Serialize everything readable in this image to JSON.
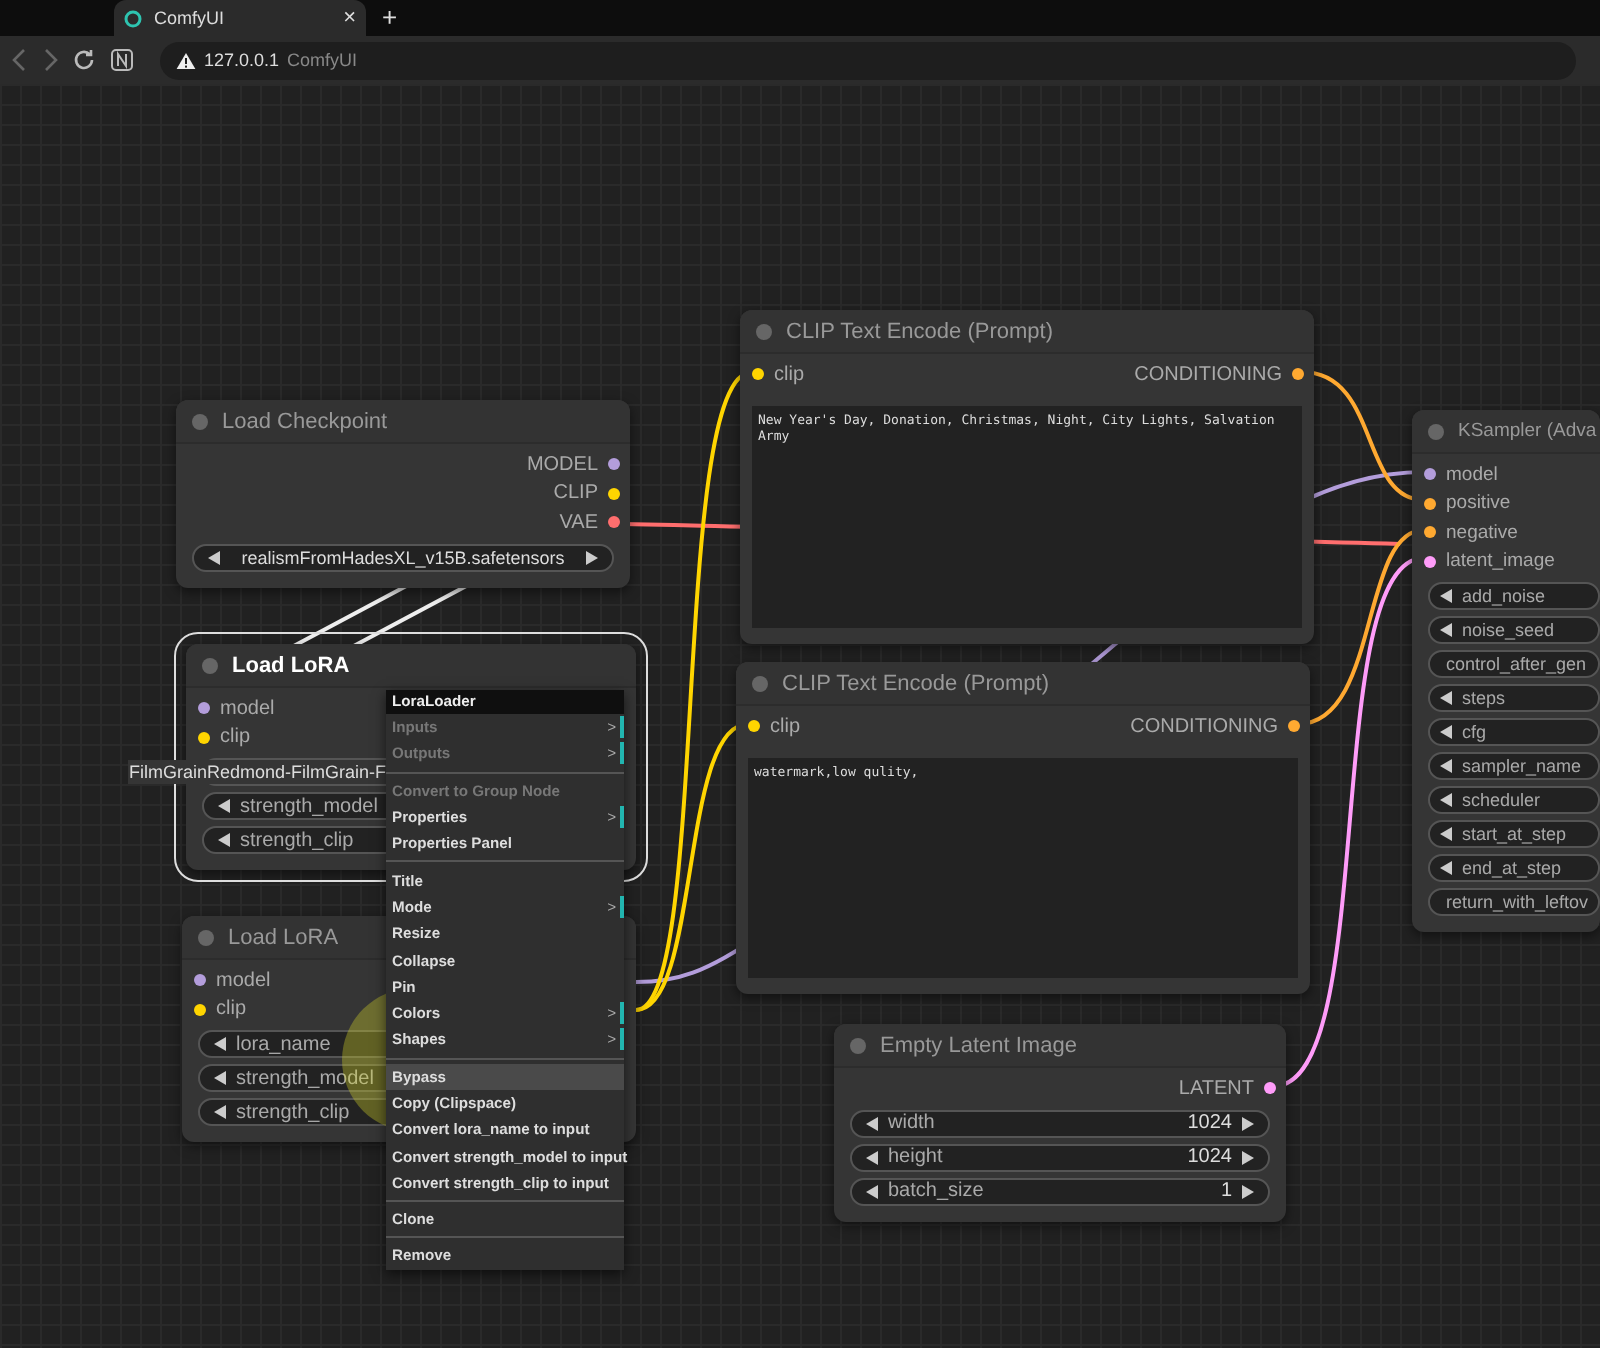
{
  "browser": {
    "tab": {
      "title": "ComfyUI",
      "close": "×"
    },
    "new_tab": "+",
    "address": {
      "host": "127.0.0.1",
      "page_title": "ComfyUI"
    }
  },
  "nodes": [
    {
      "title": "CLIP Text Encode (Prompt)",
      "selected": false,
      "inputs": [
        {
          "name": "clip",
          "color": "#ffd500"
        }
      ],
      "outputs": [
        {
          "name": "CONDITIONING",
          "color": "#ffa931"
        }
      ],
      "text": "New Year's Day, Donation, Christmas, Night, City Lights, Salvation Army"
    },
    {
      "title": "Load Checkpoint",
      "selected": false,
      "outputs": [
        {
          "name": "MODEL",
          "color": "#b39ddb"
        },
        {
          "name": "CLIP",
          "color": "#ffd500"
        },
        {
          "name": "VAE",
          "color": "#ff6e6e"
        }
      ],
      "widgets": [
        {
          "value": "realismFromHadesXL_v15B.safetensors"
        }
      ]
    },
    {
      "title": "KSampler (Adva",
      "selected": false,
      "inputs": [
        {
          "name": "model",
          "color": "#b39ddb"
        },
        {
          "name": "positive",
          "color": "#ffa931"
        },
        {
          "name": "negative",
          "color": "#ffa931"
        },
        {
          "name": "latent_image",
          "color": "#ff9cf9"
        }
      ],
      "widgets": [
        {
          "label": "add_noise"
        },
        {
          "label": "noise_seed"
        },
        {
          "label": "control_after_gen"
        },
        {
          "label": "steps"
        },
        {
          "label": "cfg"
        },
        {
          "label": "sampler_name"
        },
        {
          "label": "scheduler"
        },
        {
          "label": "start_at_step"
        },
        {
          "label": "end_at_step"
        },
        {
          "label": "return_with_leftov"
        }
      ]
    },
    {
      "title": "Load LoRA",
      "selected": true,
      "inputs": [
        {
          "name": "model",
          "color": "#b39ddb"
        },
        {
          "name": "clip",
          "color": "#ffd500"
        }
      ],
      "widgets": [
        {
          "value": "FilmGrainRedmond-FilmGrain-F"
        },
        {
          "label": "strength_model"
        },
        {
          "label": "strength_clip"
        }
      ]
    },
    {
      "title": "CLIP Text Encode (Prompt)",
      "selected": false,
      "inputs": [
        {
          "name": "clip",
          "color": "#ffd500"
        }
      ],
      "outputs": [
        {
          "name": "CONDITIONING",
          "color": "#ffa931"
        }
      ],
      "text": "watermark,low qulity,"
    },
    {
      "title": "Load LoRA",
      "selected": false,
      "inputs": [
        {
          "name": "model",
          "color": "#b39ddb"
        },
        {
          "name": "clip",
          "color": "#ffd500"
        }
      ],
      "widgets": [
        {
          "label": "lora_name"
        },
        {
          "label": "strength_model"
        },
        {
          "label": "strength_clip"
        }
      ]
    },
    {
      "title": "Empty Latent Image",
      "selected": false,
      "outputs": [
        {
          "name": "LATENT",
          "color": "#ff9cf9"
        }
      ],
      "widgets": [
        {
          "label": "width",
          "value": "1024"
        },
        {
          "label": "height",
          "value": "1024"
        },
        {
          "label": "batch_size",
          "value": "1"
        }
      ]
    }
  ],
  "context_menu": {
    "title": "LoraLoader",
    "items": [
      {
        "kind": "item",
        "label": "Inputs",
        "disabled": true,
        "arrow": ">",
        "highlighted": false
      },
      {
        "kind": "item",
        "label": "Outputs",
        "disabled": true,
        "arrow": ">",
        "highlighted": false
      },
      {
        "kind": "separator"
      },
      {
        "kind": "item",
        "label": "Convert to Group Node",
        "disabled": true,
        "highlighted": false
      },
      {
        "kind": "item",
        "label": "Properties",
        "disabled": false,
        "arrow": ">",
        "highlighted": false
      },
      {
        "kind": "item",
        "label": "Properties Panel",
        "disabled": false,
        "highlighted": false
      },
      {
        "kind": "separator"
      },
      {
        "kind": "item",
        "label": "Title",
        "disabled": false,
        "highlighted": false
      },
      {
        "kind": "item",
        "label": "Mode",
        "disabled": false,
        "arrow": ">",
        "highlighted": false
      },
      {
        "kind": "item",
        "label": "Resize",
        "disabled": false,
        "highlighted": false
      },
      {
        "kind": "item",
        "label": "Collapse",
        "disabled": false,
        "highlighted": false
      },
      {
        "kind": "item",
        "label": "Pin",
        "disabled": false,
        "highlighted": false
      },
      {
        "kind": "item",
        "label": "Colors",
        "disabled": false,
        "arrow": ">",
        "highlighted": false
      },
      {
        "kind": "item",
        "label": "Shapes",
        "disabled": false,
        "arrow": ">",
        "highlighted": false
      },
      {
        "kind": "separator"
      },
      {
        "kind": "item",
        "label": "Bypass",
        "disabled": false,
        "highlighted": true
      },
      {
        "kind": "item",
        "label": "Copy (Clipspace)",
        "disabled": false,
        "highlighted": false
      },
      {
        "kind": "item",
        "label": "Convert lora_name to input",
        "disabled": false,
        "highlighted": false
      },
      {
        "kind": "item",
        "label": "Convert strength_model to input",
        "disabled": false,
        "highlighted": false
      },
      {
        "kind": "item",
        "label": "Convert strength_clip to input",
        "disabled": false,
        "highlighted": false
      },
      {
        "kind": "separator"
      },
      {
        "kind": "item",
        "label": "Clone",
        "disabled": false,
        "highlighted": false
      },
      {
        "kind": "separator"
      },
      {
        "kind": "item",
        "label": "Remove",
        "disabled": false,
        "highlighted": false
      }
    ]
  }
}
